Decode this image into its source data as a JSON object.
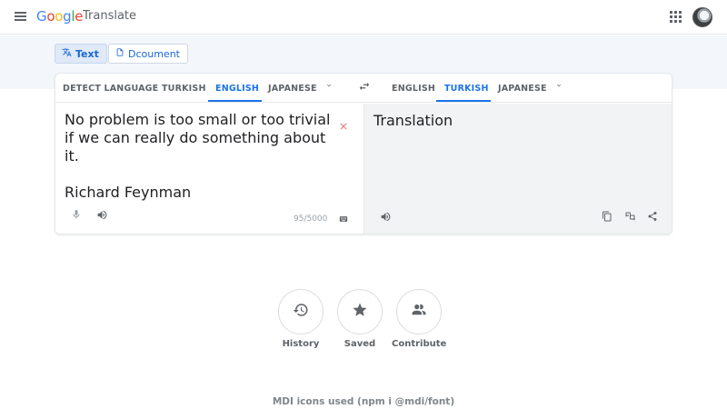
{
  "header": {
    "brand_letters": [
      "G",
      "o",
      "o",
      "g",
      "l",
      "e"
    ],
    "product": "Translate",
    "menu_icon": "menu-icon",
    "apps_icon": "apps-grid-icon",
    "avatar": "user-avatar"
  },
  "modes": [
    {
      "label": "Text",
      "icon": "translate-icon",
      "active": true
    },
    {
      "label": "Dcoument",
      "icon": "document-icon",
      "active": false
    }
  ],
  "source": {
    "languages": [
      "DETECT LANGUAGE",
      "TURKISH",
      "ENGLISH",
      "JAPANESE"
    ],
    "selected": "ENGLISH",
    "text": "No problem is too small or too trivial if we can really do something about it.\n\nRichard Feynman",
    "char_count": "95/5000"
  },
  "target": {
    "languages": [
      "ENGLISH",
      "TURKISH",
      "JAPANESE"
    ],
    "selected": "TURKISH",
    "text": "Translation"
  },
  "actions": [
    {
      "label": "History",
      "icon": "history-icon"
    },
    {
      "label": "Saved",
      "icon": "star-icon"
    },
    {
      "label": "Contribute",
      "icon": "people-icon"
    }
  ],
  "footer": "MDI icons used (npm i @mdi/font)",
  "colors": {
    "accent": "#1a73e8",
    "clear": "#e57373",
    "target_bg": "#f1f3f4",
    "band_bg": "#f3f6fb"
  }
}
